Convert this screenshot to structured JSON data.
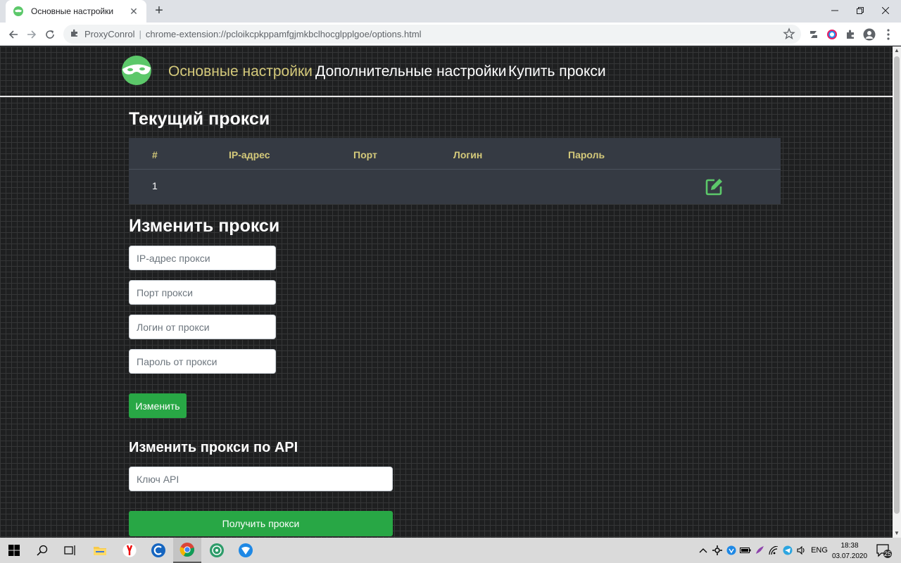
{
  "browser": {
    "tab_title": "Основные настройки",
    "site_name": "ProxyConrol",
    "url": "chrome-extension://pcloikcpkppamfgjmkbclhocglpplgoe/options.html"
  },
  "nav": {
    "items": [
      {
        "label": "Основные настройки",
        "active": true
      },
      {
        "label": "Дополнительные настройки",
        "active": false
      },
      {
        "label": "Купить прокси",
        "active": false
      }
    ]
  },
  "current_proxy": {
    "heading": "Текущий прокси",
    "columns": [
      "#",
      "IP-адрес",
      "Порт",
      "Логин",
      "Пароль"
    ],
    "rows": [
      {
        "num": "1",
        "ip": "",
        "port": "",
        "login": "",
        "password": ""
      }
    ]
  },
  "edit_proxy": {
    "heading": "Изменить прокси",
    "ip_placeholder": "IP-адрес прокси",
    "port_placeholder": "Порт прокси",
    "login_placeholder": "Логин от прокси",
    "password_placeholder": "Пароль от прокси",
    "submit_label": "Изменить"
  },
  "api": {
    "heading": "Изменить прокси по API",
    "key_placeholder": "Ключ API",
    "submit_label": "Получить прокси"
  },
  "taskbar": {
    "lang": "ENG",
    "time": "18:38",
    "date": "03.07.2020",
    "notification_count": "25"
  },
  "colors": {
    "accent_gold": "#d4c97a",
    "button_green": "#28a745",
    "table_bg": "#353a43",
    "logo_green": "#5cc86a"
  }
}
